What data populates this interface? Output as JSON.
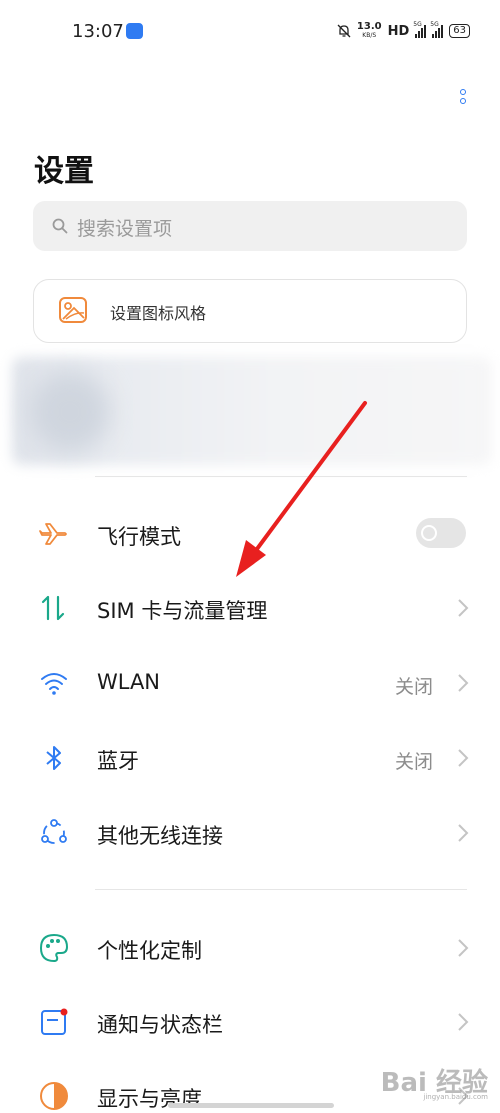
{
  "status_bar": {
    "time": "13:07",
    "net_speed_value": "13.0",
    "net_speed_unit": "KB/S",
    "hd_label": "HD",
    "signal_label": "5G",
    "battery": "63"
  },
  "header": {
    "title": "设置"
  },
  "search": {
    "placeholder": "搜索设置项"
  },
  "icon_style": {
    "label": "设置图标风格"
  },
  "items": [
    {
      "label": "飞行模式",
      "value": "",
      "icon": "airplane-icon",
      "control": "toggle",
      "toggle_on": false
    },
    {
      "label": "SIM 卡与流量管理",
      "value": "",
      "icon": "sim-data-icon",
      "control": "chevron"
    },
    {
      "label": "WLAN",
      "value": "关闭",
      "icon": "wifi-icon",
      "control": "chevron"
    },
    {
      "label": "蓝牙",
      "value": "关闭",
      "icon": "bluetooth-icon",
      "control": "chevron"
    },
    {
      "label": "其他无线连接",
      "value": "",
      "icon": "wireless-connections-icon",
      "control": "chevron"
    },
    {
      "label": "个性化定制",
      "value": "",
      "icon": "palette-icon",
      "control": "chevron"
    },
    {
      "label": "通知与状态栏",
      "value": "",
      "icon": "notification-icon",
      "control": "chevron"
    },
    {
      "label": "显示与亮度",
      "value": "",
      "icon": "brightness-icon",
      "control": "chevron"
    }
  ],
  "watermark": {
    "text": "Bai 经验",
    "sub": "jingyan.baidu.com"
  },
  "colors": {
    "accent": "#2f7bf2",
    "annotation_arrow": "#e8201f",
    "orange": "#f08a3c",
    "green": "#1aa88a"
  }
}
